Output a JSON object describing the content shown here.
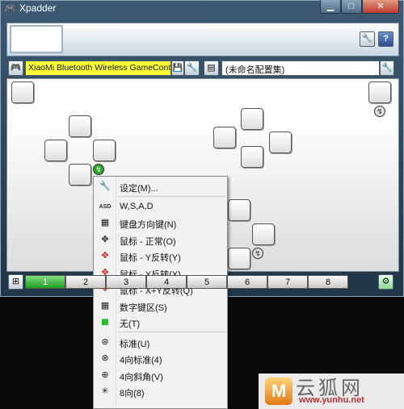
{
  "window": {
    "title": "Xpadder",
    "minimize_icon": "minimize-icon",
    "maximize_icon": "maximize-icon",
    "close_icon": "close-icon",
    "minimize_label": "▁",
    "maximize_label": "□",
    "close_label": "✕"
  },
  "header": {
    "settings_glyph": "🔧",
    "help_glyph": "?"
  },
  "controller": {
    "name": "XiaoMi Bluetooth Wireless GameController",
    "icon": "gamepad-icon"
  },
  "config": {
    "name": "(未命名配置集)",
    "icon": "profile-icon"
  },
  "badges": {
    "green": "↯",
    "gray": "↯"
  },
  "tabs": {
    "items": [
      "1",
      "2",
      "3",
      "4",
      "5",
      "6",
      "7",
      "8"
    ],
    "active_index": 0,
    "accent": "#22a022"
  },
  "context_menu": {
    "items": [
      {
        "label": "设定(M)...",
        "icon": "wrench-icon",
        "glyph": "🔧",
        "color": "#666666"
      },
      {
        "label": "W,S,A,D",
        "icon": "wasd-icon",
        "glyph": "ASD",
        "color": "#222222"
      },
      {
        "label": "键盘方向键(N)",
        "icon": "arrow-keys-icon",
        "glyph": "▦",
        "color": "#222222"
      },
      {
        "label": "鼠标 - 正常(O)",
        "icon": "mouse-normal-icon",
        "glyph": "✥",
        "color": "#222222"
      },
      {
        "label": "鼠标 - Y反转(Y)",
        "icon": "mouse-invert-y-icon",
        "glyph": "✥",
        "color": "#d01818"
      },
      {
        "label": "鼠标 - X反转(X)",
        "icon": "mouse-invert-x-icon",
        "glyph": "✥",
        "color": "#d01818"
      },
      {
        "label": "鼠标 - X+Y反转(Q)",
        "icon": "mouse-invert-xy-icon",
        "glyph": "✥",
        "color": "#d01818"
      },
      {
        "label": "数字键区(S)",
        "icon": "numpad-icon",
        "glyph": "▦",
        "color": "#222222"
      },
      {
        "label": "无(T)",
        "icon": "none-green-square-icon",
        "glyph": "■",
        "color": "#22c022"
      },
      {
        "label": "标准(U)",
        "icon": "standard-stick-icon",
        "glyph": "⊛",
        "color": "#222222"
      },
      {
        "label": "4向标准(4)",
        "icon": "four-way-standard-icon",
        "glyph": "⊗",
        "color": "#222222"
      },
      {
        "label": "4向斜角(V)",
        "icon": "four-way-diagonal-icon",
        "glyph": "⊕",
        "color": "#222222"
      },
      {
        "label": "8向(8)",
        "icon": "eight-way-icon",
        "glyph": "✳",
        "color": "#222222"
      }
    ]
  },
  "watermark": {
    "logo_letter": "M",
    "site_name": "云狐网",
    "url": "www.yunhu.net"
  },
  "colors": {
    "window_frame": "#2d4860",
    "controller_field": "#ffff33",
    "active_tab": "#22a022"
  }
}
